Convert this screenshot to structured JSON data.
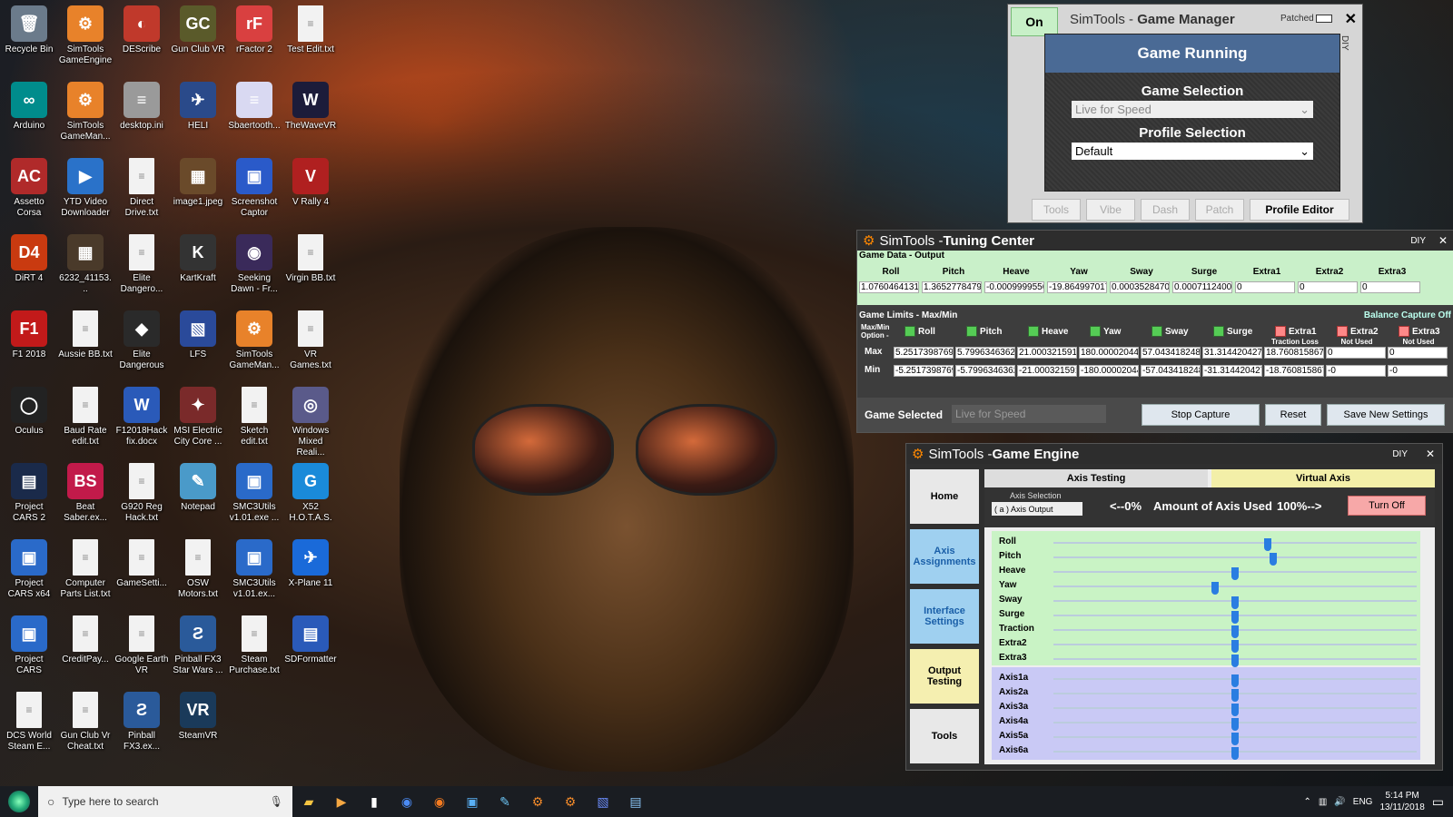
{
  "desktop": {
    "icons": [
      {
        "label": "Recycle Bin",
        "glyph": "🗑",
        "color": "#6b7b8b"
      },
      {
        "label": "SimTools GameEngine",
        "glyph": "⚙",
        "color": "#e8822a"
      },
      {
        "label": "DEScribe",
        "glyph": "◐",
        "color": "#c0392b"
      },
      {
        "label": "Gun Club VR",
        "glyph": "GC",
        "color": "#5a5a2a"
      },
      {
        "label": "rFactor 2",
        "glyph": "rF",
        "color": "#d94040"
      },
      {
        "label": "Test Edit.txt",
        "glyph": "≡",
        "color": "#f2f2f2"
      },
      {
        "label": "Arduino",
        "glyph": "∞",
        "color": "#008c8c"
      },
      {
        "label": "SimTools GameMan...",
        "glyph": "⚙",
        "color": "#e8822a"
      },
      {
        "label": "desktop.ini",
        "glyph": "≡",
        "color": "#9a9a9a"
      },
      {
        "label": "HELI",
        "glyph": "✈",
        "color": "#2a4a8a"
      },
      {
        "label": "Sbaertooth...",
        "glyph": "≡",
        "color": "#d9d9f2"
      },
      {
        "label": "TheWaveVR",
        "glyph": "W",
        "color": "#1c1c3a"
      },
      {
        "label": "Assetto Corsa",
        "glyph": "AC",
        "color": "#b02a2a"
      },
      {
        "label": "YTD Video Downloader",
        "glyph": "▶",
        "color": "#2a72c9"
      },
      {
        "label": "Direct Drive.txt",
        "glyph": "≡",
        "color": "#f2f2f2"
      },
      {
        "label": "image1.jpeg",
        "glyph": "▦",
        "color": "#6a4a2a"
      },
      {
        "label": "Screenshot Captor",
        "glyph": "▣",
        "color": "#2a5ac9"
      },
      {
        "label": "V Rally 4",
        "glyph": "V",
        "color": "#b02020"
      },
      {
        "label": "DiRT 4",
        "glyph": "D4",
        "color": "#c93a10"
      },
      {
        "label": "6232_41153...",
        "glyph": "▦",
        "color": "#4a3a2a"
      },
      {
        "label": "Elite Dangero...",
        "glyph": "≡",
        "color": "#f2f2f2"
      },
      {
        "label": "KartKraft",
        "glyph": "K",
        "color": "#333333"
      },
      {
        "label": "Seeking Dawn - Fr...",
        "glyph": "◉",
        "color": "#3a2a5a"
      },
      {
        "label": "Virgin BB.txt",
        "glyph": "≡",
        "color": "#f2f2f2"
      },
      {
        "label": "F1 2018",
        "glyph": "F1",
        "color": "#c21a1a"
      },
      {
        "label": "Aussie BB.txt",
        "glyph": "≡",
        "color": "#f2f2f2"
      },
      {
        "label": "Elite Dangerous",
        "glyph": "◆",
        "color": "#2a2a2a"
      },
      {
        "label": "LFS",
        "glyph": "▧",
        "color": "#2a4a9a"
      },
      {
        "label": "SimTools GameMan...",
        "glyph": "⚙",
        "color": "#e8822a"
      },
      {
        "label": "VR Games.txt",
        "glyph": "≡",
        "color": "#f2f2f2"
      },
      {
        "label": "Oculus",
        "glyph": "◯",
        "color": "#222222"
      },
      {
        "label": "Baud Rate edit.txt",
        "glyph": "≡",
        "color": "#f2f2f2"
      },
      {
        "label": "F12018Hack fix.docx",
        "glyph": "W",
        "color": "#2a5ab9"
      },
      {
        "label": "MSI Electric City Core ...",
        "glyph": "✦",
        "color": "#7a2a2a"
      },
      {
        "label": "Sketch edit.txt",
        "glyph": "≡",
        "color": "#f2f2f2"
      },
      {
        "label": "Windows Mixed Reali...",
        "glyph": "◎",
        "color": "#5a5a8a"
      },
      {
        "label": "Project CARS 2",
        "glyph": "▤",
        "color": "#1a2a4a"
      },
      {
        "label": "Beat Saber.ex...",
        "glyph": "BS",
        "color": "#c21a4a"
      },
      {
        "label": "G920 Reg Hack.txt",
        "glyph": "≡",
        "color": "#f2f2f2"
      },
      {
        "label": "Notepad",
        "glyph": "✎",
        "color": "#4a9ac9"
      },
      {
        "label": "SMC3Utils v1.01.exe ...",
        "glyph": "▣",
        "color": "#2a6ac9"
      },
      {
        "label": "X52 H.O.T.A.S.",
        "glyph": "G",
        "color": "#1a8ad9"
      },
      {
        "label": "Project CARS x64",
        "glyph": "▣",
        "color": "#2a6ac9"
      },
      {
        "label": "Computer Parts List.txt",
        "glyph": "≡",
        "color": "#f2f2f2"
      },
      {
        "label": "GameSetti...",
        "glyph": "≡",
        "color": "#f2f2f2"
      },
      {
        "label": "OSW Motors.txt",
        "glyph": "≡",
        "color": "#f2f2f2"
      },
      {
        "label": "SMC3Utils v1.01.ex...",
        "glyph": "▣",
        "color": "#2a6ac9"
      },
      {
        "label": "X-Plane 11",
        "glyph": "✈",
        "color": "#1a6ad9"
      },
      {
        "label": "Project CARS",
        "glyph": "▣",
        "color": "#2a6ac9"
      },
      {
        "label": "CreditPay...",
        "glyph": "≡",
        "color": "#f2f2f2"
      },
      {
        "label": "Google Earth VR",
        "glyph": "≡",
        "color": "#f2f2f2"
      },
      {
        "label": "Pinball FX3 Star Wars ...",
        "glyph": "Ƨ",
        "color": "#2a5a9a"
      },
      {
        "label": "Steam Purchase.txt",
        "glyph": "≡",
        "color": "#f2f2f2"
      },
      {
        "label": "SDFormatter",
        "glyph": "▤",
        "color": "#2a5ab9"
      },
      {
        "label": "DCS World Steam E...",
        "glyph": "≡",
        "color": "#f2f2f2"
      },
      {
        "label": "Gun Club Vr Cheat.txt",
        "glyph": "≡",
        "color": "#f2f2f2"
      },
      {
        "label": "Pinball FX3.ex...",
        "glyph": "Ƨ",
        "color": "#2a5a9a"
      },
      {
        "label": "SteamVR",
        "glyph": "VR",
        "color": "#1a3a5a"
      }
    ]
  },
  "game_manager": {
    "on_label": "On",
    "title_prefix": "SimTools - ",
    "title_bold": "Game Manager",
    "patched": "Patched",
    "close": "✕",
    "diy": "DIY",
    "status": "Game Running",
    "game_selection_label": "Game Selection",
    "game_selection_value": "Live for Speed",
    "profile_selection_label": "Profile Selection",
    "profile_selection_value": "Default",
    "tabs": [
      "Tools",
      "Vibe",
      "Dash",
      "Patch",
      "Profile Editor"
    ]
  },
  "tuning_center": {
    "title_prefix": "SimTools - ",
    "title_bold": "Tuning Center",
    "diy": "DIY",
    "section1_label": "Game Data - Output",
    "columns": [
      "Roll",
      "Pitch",
      "Heave",
      "Yaw",
      "Sway",
      "Surge",
      "Extra1",
      "Extra2",
      "Extra3"
    ],
    "output_values": [
      "1.07604641310",
      "1.36527784799",
      "-0.0009999556",
      "-19.864997017",
      "0.00035284709",
      "0.00071124007",
      "0",
      "0",
      "0"
    ],
    "section2_label": "Game Limits - Max/Min",
    "balance_capture": "Balance Capture Off",
    "maxmin_option": "Max/Min Option -",
    "limit_labels": [
      "Roll",
      "Pitch",
      "Heave",
      "Yaw",
      "Sway",
      "Surge",
      "Extra1",
      "Extra2",
      "Extra3"
    ],
    "sub_labels": [
      "",
      "",
      "",
      "",
      "",
      "",
      "Traction Loss",
      "Not Used",
      "Not Used"
    ],
    "max_label": "Max",
    "min_label": "Min",
    "max_values": [
      "5.2517398769",
      "5.7996346362",
      "21.000321591",
      "180.00002044",
      "57.043418248",
      "31.314420427",
      "18.760815867",
      "0",
      "0"
    ],
    "min_values": [
      "-5.2517398769",
      "-5.7996346362",
      "-21.000321591",
      "-180.00002044",
      "-57.043418248",
      "-31.314420427",
      "-18.760815867",
      "-0",
      "-0"
    ],
    "game_selected_label": "Game Selected",
    "game_selected_value": "Live for Speed",
    "stop_capture": "Stop Capture",
    "reset": "Reset",
    "save_new": "Save New Settings"
  },
  "game_engine": {
    "title_prefix": "SimTools - ",
    "title_bold": "Game Engine",
    "diy": "DIY",
    "nav": [
      "Home",
      "Axis Assignments",
      "Interface Settings",
      "Output Testing",
      "Tools"
    ],
    "tab_axis_testing": "Axis Testing",
    "tab_virtual_axis": "Virtual Axis",
    "axis_selection_label": "Axis Selection",
    "axis_selection_value": "( a ) Axis Output",
    "amount_left": "<--0%",
    "amount_label": "Amount of Axis Used",
    "amount_right": "100%-->",
    "turn_off": "Turn Off",
    "game_axes": [
      {
        "name": "Roll",
        "pos": 0.59
      },
      {
        "name": "Pitch",
        "pos": 0.605
      },
      {
        "name": "Heave",
        "pos": 0.5
      },
      {
        "name": "Yaw",
        "pos": 0.445
      },
      {
        "name": "Sway",
        "pos": 0.5
      },
      {
        "name": "Surge",
        "pos": 0.5
      },
      {
        "name": "Traction",
        "pos": 0.5
      },
      {
        "name": "Extra2",
        "pos": 0.5
      },
      {
        "name": "Extra3",
        "pos": 0.5
      }
    ],
    "output_axes": [
      {
        "name": "Axis1a",
        "pos": 0.5
      },
      {
        "name": "Axis2a",
        "pos": 0.5
      },
      {
        "name": "Axis3a",
        "pos": 0.5
      },
      {
        "name": "Axis4a",
        "pos": 0.5
      },
      {
        "name": "Axis5a",
        "pos": 0.5
      },
      {
        "name": "Axis6a",
        "pos": 0.5
      }
    ]
  },
  "taskbar": {
    "search_placeholder": "Type here to search",
    "time": "5:14 PM",
    "date": "13/11/2018",
    "lang": "ENG"
  }
}
